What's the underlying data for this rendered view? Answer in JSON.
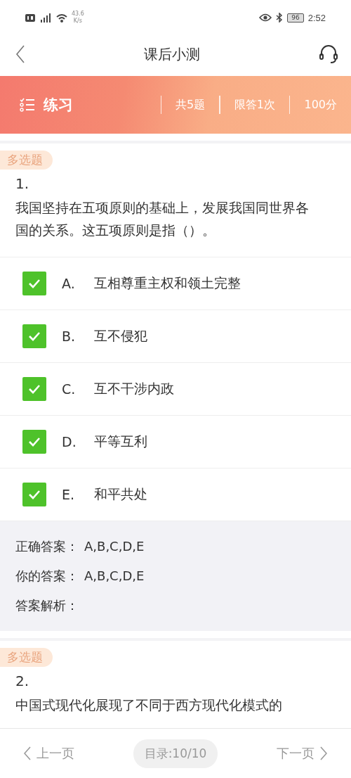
{
  "status_bar": {
    "network_speed": "43.6",
    "speed_unit": "K/s",
    "battery": "96",
    "time": "2:52"
  },
  "header": {
    "title": "课后小测"
  },
  "banner": {
    "title": "练习",
    "stats": [
      "共5题",
      "限答1次",
      "100分"
    ]
  },
  "questions": [
    {
      "type": "多选题",
      "number": "1.",
      "text": "我国坚持在五项原则的基础上，发展我国同世界各国的关系。这五项原则是指（）。",
      "options": [
        {
          "letter": "A.",
          "text": "互相尊重主权和领土完整",
          "checked": true
        },
        {
          "letter": "B.",
          "text": "互不侵犯",
          "checked": true
        },
        {
          "letter": "C.",
          "text": "互不干涉内政",
          "checked": true
        },
        {
          "letter": "D.",
          "text": "平等互利",
          "checked": true
        },
        {
          "letter": "E.",
          "text": "和平共处",
          "checked": true
        }
      ],
      "answers": [
        {
          "label": "正确答案：",
          "value": "A,B,C,D,E"
        },
        {
          "label": "你的答案：",
          "value": "A,B,C,D,E"
        },
        {
          "label": "答案解析："
        }
      ]
    },
    {
      "type": "多选题",
      "number": "2.",
      "text": "中国式现代化展现了不同于西方现代化模式的"
    }
  ],
  "footer": {
    "prev": "上一页",
    "index": "目录:10/10",
    "next": "下一页"
  }
}
